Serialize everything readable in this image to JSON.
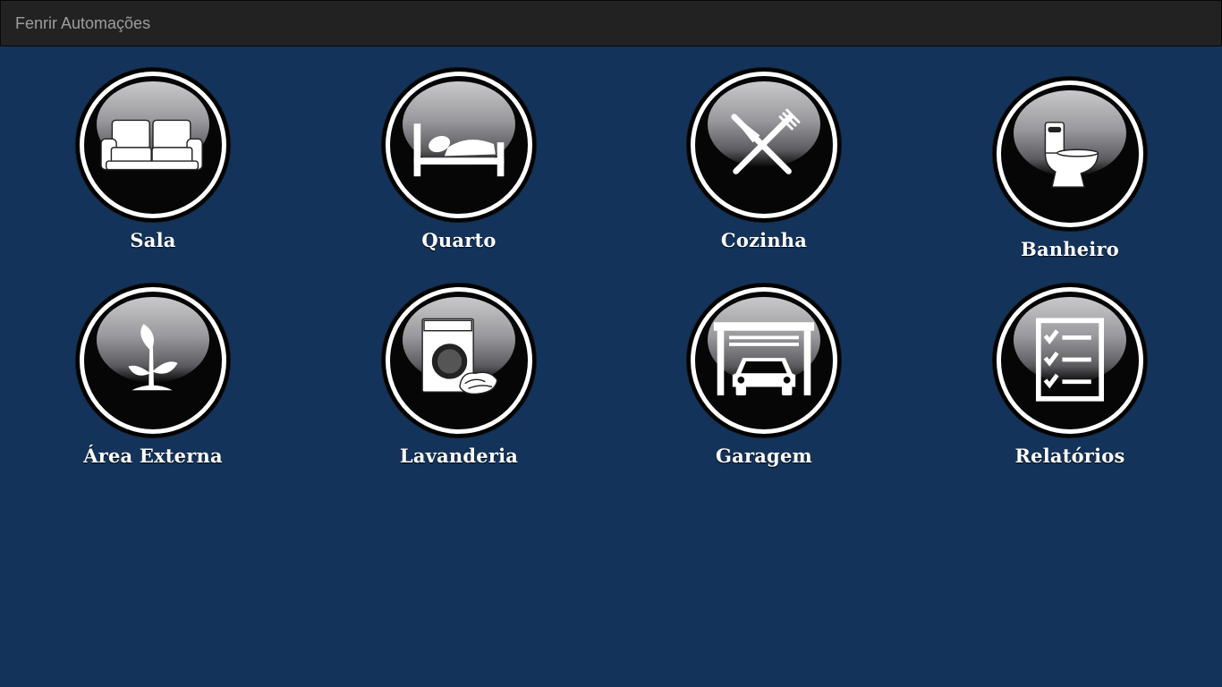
{
  "app": {
    "title": "Fenrir Automações"
  },
  "tiles": [
    {
      "label": "Sala",
      "icon": "sofa-icon"
    },
    {
      "label": "Quarto",
      "icon": "bed-icon"
    },
    {
      "label": "Cozinha",
      "icon": "fork-knife-icon"
    },
    {
      "label": "Banheiro",
      "icon": "toilet-icon"
    },
    {
      "label": "Área Externa",
      "icon": "plant-icon"
    },
    {
      "label": "Lavanderia",
      "icon": "washing-machine-icon"
    },
    {
      "label": "Garagem",
      "icon": "garage-car-icon"
    },
    {
      "label": "Relatórios",
      "icon": "checklist-icon"
    }
  ],
  "colors": {
    "background": "#13335a",
    "navbar": "#222222",
    "brand_text": "#9d9d9d",
    "label_text": "#ffffff"
  }
}
